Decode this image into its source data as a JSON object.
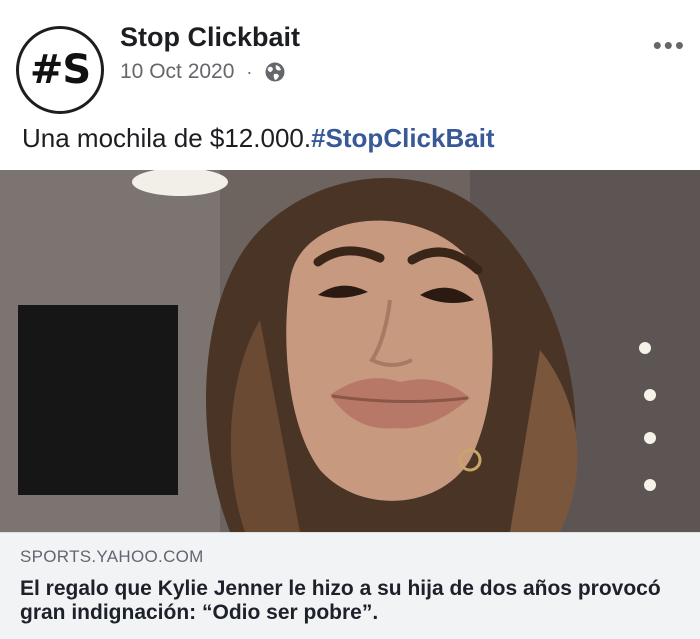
{
  "header": {
    "avatar_text": "#S",
    "page_name": "Stop Clickbait",
    "date": "10 Oct 2020",
    "separator": "·",
    "audience_icon": "globe-icon",
    "more_icon": "more-options-icon",
    "more_label": "•••"
  },
  "post": {
    "text": "Una mochila de $12.000.",
    "hashtag": "#StopClickBait"
  },
  "link_preview": {
    "domain": "SPORTS.YAHOO.COM",
    "headline": "El regalo que Kylie Jenner le hizo a su hija de dos años provocó gran indignación: “Odio ser pobre”."
  },
  "colors": {
    "text": "#1c1e21",
    "muted": "#65676b",
    "hashtag": "#385898",
    "preview_bg": "#f2f3f5"
  }
}
